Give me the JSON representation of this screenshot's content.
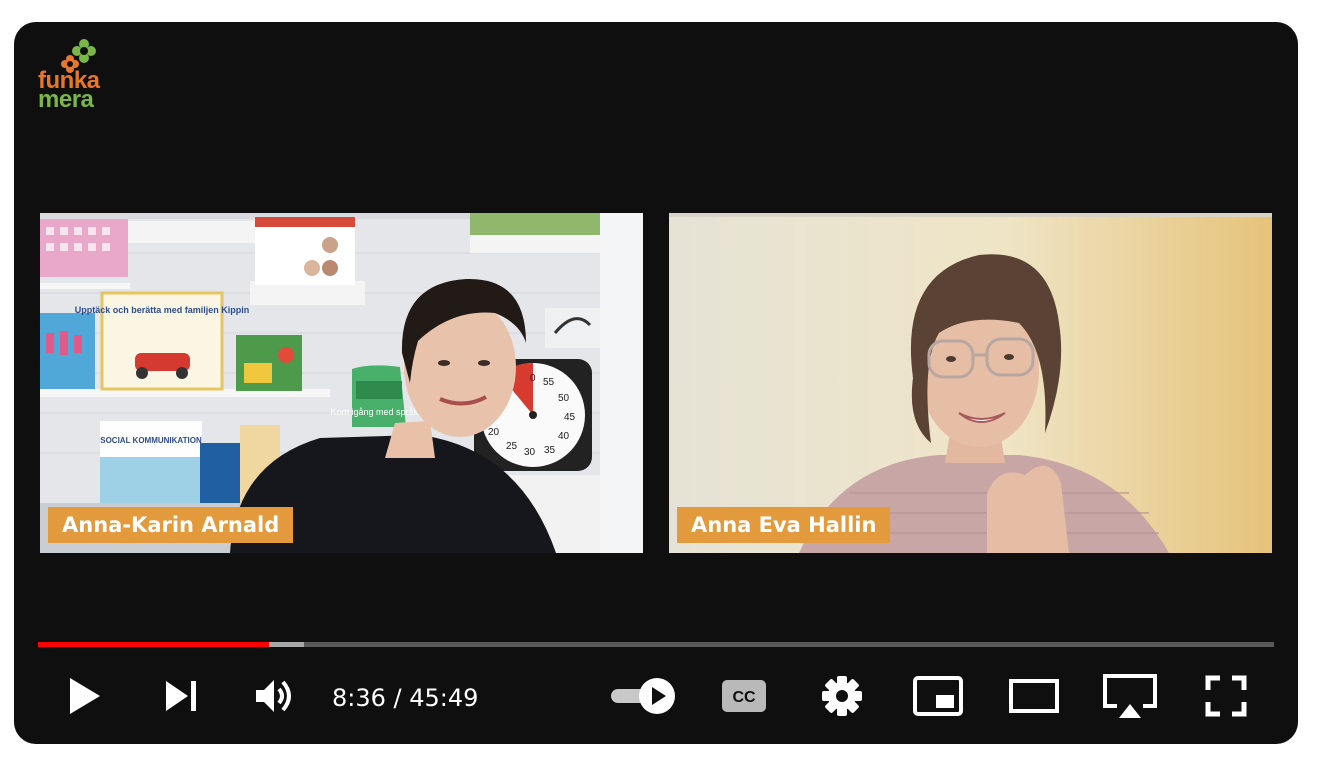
{
  "channel_logo": {
    "line1": "funka",
    "line2": "mera"
  },
  "participants": [
    {
      "name": "Anna-Karin Arnald"
    },
    {
      "name": "Anna Eva Hallin"
    }
  ],
  "left_scene": {
    "book1": "Upptäck och berätta med familjen Kippin",
    "book2": "SOCIAL KOMMUNIKATION",
    "bag": "Kom igång med språket",
    "timer_numbers": [
      "0",
      "55",
      "50",
      "45",
      "40",
      "35",
      "30",
      "25",
      "20"
    ]
  },
  "player": {
    "current_time": "8:36",
    "duration": "45:49",
    "time_display": "8:36 / 45:49",
    "progress_fraction": 0.187,
    "buffer_fraction": 0.215,
    "autoplay": true,
    "accent_color": "#ff0000"
  },
  "controls": {
    "play_icon": "play-icon",
    "next_icon": "next-icon",
    "volume_icon": "volume-icon",
    "autoplay_icon": "autoplay-toggle-icon",
    "cc_label": "CC",
    "settings_icon": "gear-icon",
    "miniplayer_icon": "miniplayer-icon",
    "theater_icon": "theater-icon",
    "airplay_icon": "airplay-icon",
    "fullscreen_icon": "fullscreen-icon"
  }
}
